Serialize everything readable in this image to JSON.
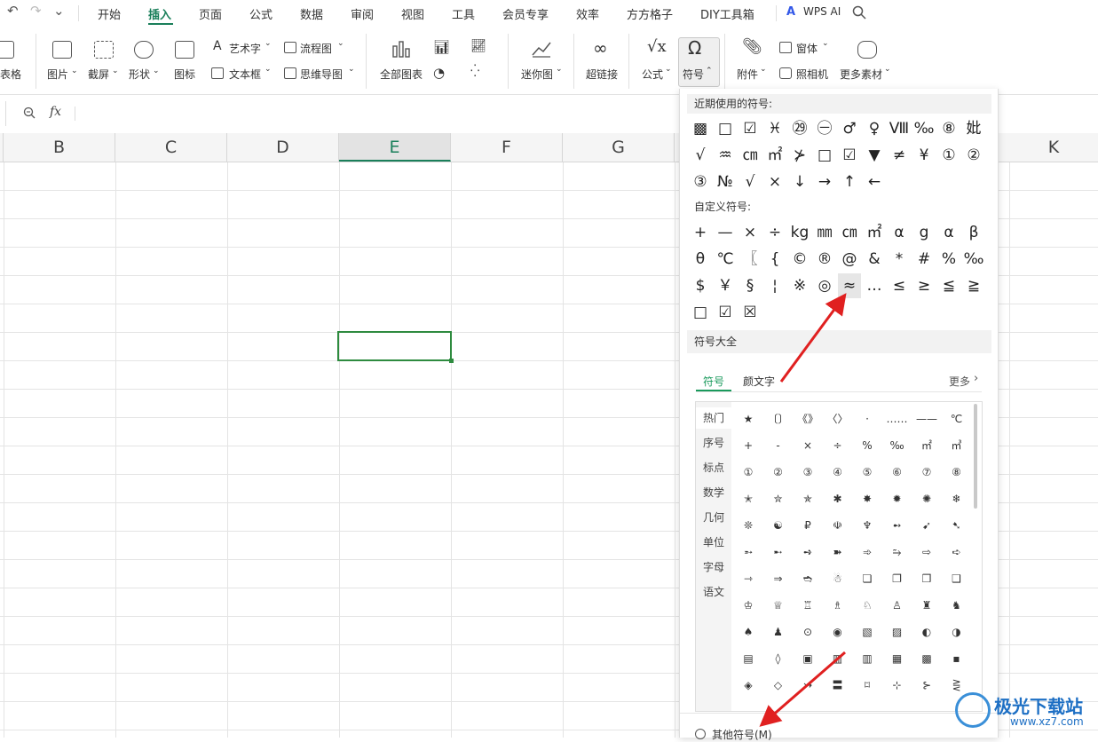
{
  "quick_access": {
    "undo": "↶",
    "redo": "↷",
    "more": "⌄"
  },
  "menu": {
    "items": [
      "开始",
      "插入",
      "页面",
      "公式",
      "数据",
      "审阅",
      "视图",
      "工具",
      "会员专享",
      "效率",
      "方方格子",
      "DIY工具箱"
    ],
    "active": "插入",
    "wps_ai": "WPS AI"
  },
  "ribbon": {
    "table": "表格",
    "picture": "图片",
    "screenshot": "截屏",
    "shape": "形状",
    "icon": "图标",
    "wordart": "艺术字",
    "textbox": "文本框",
    "flowchart": "流程图",
    "mindmap": "思维导图",
    "all_charts": "全部图表",
    "sparkline": "迷你图",
    "hyperlink": "超链接",
    "formula": "公式",
    "symbol": "符号",
    "attachment": "附件",
    "window": "窗体",
    "camera": "照相机",
    "more_material": "更多素材"
  },
  "formula_bar": {
    "fx": "fx",
    "zoom_icon": "search-icon"
  },
  "columns": [
    "B",
    "C",
    "D",
    "E",
    "F",
    "G",
    "K"
  ],
  "selected_column": "E",
  "symbol_panel": {
    "recent_title": "近期使用的符号:",
    "recent": [
      "▩",
      "□",
      "☑",
      "♓",
      "㉙",
      "㊀",
      "♂",
      "♀",
      "Ⅷ",
      "‰",
      "⑧",
      "妣",
      "√",
      "♒",
      "㎝",
      "㎡",
      "⊁",
      "□",
      "☑",
      "▼",
      "≠",
      "¥",
      "①",
      "②",
      "③",
      "№",
      "√",
      "×",
      "↓",
      "→",
      "↑",
      "←"
    ],
    "custom_title": "自定义符号:",
    "custom": [
      "+",
      "—",
      "×",
      "÷",
      "kg",
      "㎜",
      "㎝",
      "㎡",
      "α",
      "g",
      "α",
      "β",
      "θ",
      "℃",
      "〖",
      "{",
      "©",
      "®",
      "@",
      "&",
      "*",
      "#",
      "%",
      "‰",
      "$",
      "￥",
      "§",
      "¦",
      "※",
      "◎",
      "≈",
      "…",
      "≤",
      "≥",
      "≦",
      "≧",
      "□",
      "☑",
      "☒"
    ],
    "all_title": "符号大全",
    "tabs": [
      "符号",
      "颜文字"
    ],
    "active_tab": "符号",
    "more": "更多",
    "categories": [
      "热门",
      "序号",
      "标点",
      "数学",
      "几何",
      "单位",
      "字母",
      "语文"
    ],
    "active_category": "热门",
    "grid": [
      [
        "★",
        "〔〕",
        "《》",
        "〈〉",
        "·",
        "……",
        "——",
        "℃"
      ],
      [
        "+",
        "-",
        "×",
        "÷",
        "%",
        "‰",
        "㎡",
        "㎥"
      ],
      [
        "①",
        "②",
        "③",
        "④",
        "⑤",
        "⑥",
        "⑦",
        "⑧"
      ],
      [
        "✭",
        "✮",
        "✯",
        "✱",
        "✸",
        "✹",
        "✺",
        "❄"
      ],
      [
        "❊",
        "☯",
        "₽",
        "☫",
        "♆",
        "➻",
        "➹",
        "➷"
      ],
      [
        "➵",
        "➸",
        "➺",
        "➽",
        "➾",
        "⥲",
        "⇨",
        "➪"
      ],
      [
        "⇾",
        "⇒",
        "➬",
        "☃",
        "❏",
        "❐",
        "❒",
        "❑"
      ],
      [
        "♔",
        "♕",
        "♖",
        "♗",
        "♘",
        "♙",
        "♜",
        "♞"
      ],
      [
        "♠",
        "♟",
        "⊙",
        "◉",
        "▧",
        "▨",
        "◐",
        "◑"
      ],
      [
        "▤",
        "◊",
        "▣",
        "▥",
        "▥",
        "▦",
        "▩",
        "▪"
      ],
      [
        "◈",
        "◇",
        "↣",
        "〓",
        "⌑",
        "⊹",
        "⊱",
        "⋛"
      ]
    ],
    "other_symbols": "其他符号(M)"
  },
  "watermark": {
    "site": "极光下载站",
    "url": "www.xz7.com"
  }
}
